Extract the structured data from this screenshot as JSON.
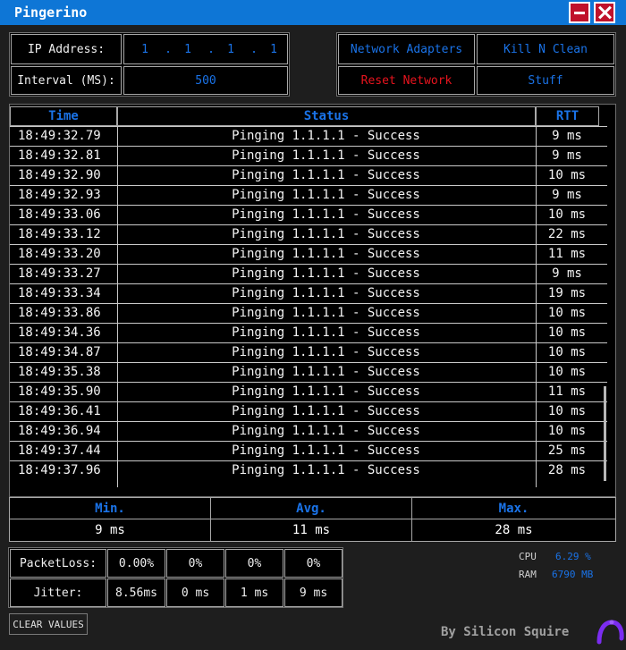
{
  "window": {
    "title": "Pingerino"
  },
  "config": {
    "ip_label": "IP Address:",
    "ip_octets": [
      "1",
      "1",
      "1",
      "1"
    ],
    "ip_sep": ".",
    "interval_label": "Interval (MS):",
    "interval_value": "500"
  },
  "actions": {
    "network_adapters": "Network Adapters",
    "kill_n_clean": "Kill N Clean",
    "reset_network": "Reset Network",
    "stuff": "Stuff"
  },
  "log": {
    "columns": [
      "Time",
      "Status",
      "RTT"
    ],
    "rows": [
      {
        "time": "18:49:32.79",
        "status": "Pinging 1.1.1.1 - Success",
        "rtt": "9 ms"
      },
      {
        "time": "18:49:32.81",
        "status": "Pinging 1.1.1.1 - Success",
        "rtt": "9 ms"
      },
      {
        "time": "18:49:32.90",
        "status": "Pinging 1.1.1.1 - Success",
        "rtt": "10 ms"
      },
      {
        "time": "18:49:32.93",
        "status": "Pinging 1.1.1.1 - Success",
        "rtt": "9 ms"
      },
      {
        "time": "18:49:33.06",
        "status": "Pinging 1.1.1.1 - Success",
        "rtt": "10 ms"
      },
      {
        "time": "18:49:33.12",
        "status": "Pinging 1.1.1.1 - Success",
        "rtt": "22 ms"
      },
      {
        "time": "18:49:33.20",
        "status": "Pinging 1.1.1.1 - Success",
        "rtt": "11 ms"
      },
      {
        "time": "18:49:33.27",
        "status": "Pinging 1.1.1.1 - Success",
        "rtt": "9 ms"
      },
      {
        "time": "18:49:33.34",
        "status": "Pinging 1.1.1.1 - Success",
        "rtt": "19 ms"
      },
      {
        "time": "18:49:33.86",
        "status": "Pinging 1.1.1.1 - Success",
        "rtt": "10 ms"
      },
      {
        "time": "18:49:34.36",
        "status": "Pinging 1.1.1.1 - Success",
        "rtt": "10 ms"
      },
      {
        "time": "18:49:34.87",
        "status": "Pinging 1.1.1.1 - Success",
        "rtt": "10 ms"
      },
      {
        "time": "18:49:35.38",
        "status": "Pinging 1.1.1.1 - Success",
        "rtt": "10 ms"
      },
      {
        "time": "18:49:35.90",
        "status": "Pinging 1.1.1.1 - Success",
        "rtt": "11 ms"
      },
      {
        "time": "18:49:36.41",
        "status": "Pinging 1.1.1.1 - Success",
        "rtt": "10 ms"
      },
      {
        "time": "18:49:36.94",
        "status": "Pinging 1.1.1.1 - Success",
        "rtt": "10 ms"
      },
      {
        "time": "18:49:37.44",
        "status": "Pinging 1.1.1.1 - Success",
        "rtt": "25 ms"
      },
      {
        "time": "18:49:37.96",
        "status": "Pinging 1.1.1.1 - Success",
        "rtt": "28 ms"
      }
    ]
  },
  "stats": {
    "min_label": "Min.",
    "min_value": "9 ms",
    "avg_label": "Avg.",
    "avg_value": "11 ms",
    "max_label": "Max.",
    "max_value": "28 ms"
  },
  "quality": {
    "packetloss_label": "PacketLoss:",
    "packetloss_values": [
      "0.00%",
      "0%",
      "0%",
      "0%"
    ],
    "jitter_label": "Jitter:",
    "jitter_values": [
      "8.56ms",
      "0 ms",
      "1 ms",
      "9 ms"
    ]
  },
  "system": {
    "cpu_label": "CPU",
    "cpu_value": "6.29 %",
    "ram_label": "RAM",
    "ram_value": "6790 MB"
  },
  "clear_button": "CLEAR VALUES",
  "footer": "By Silicon Squire",
  "colors": {
    "titlebar": "#0e76d6",
    "accent": "#1a73e8",
    "danger": "#e8141e",
    "window_close": "#c0122b"
  },
  "icons": {
    "minimize": "minimize-icon",
    "close": "close-icon",
    "logo": "silicon-squire-logo-icon"
  }
}
